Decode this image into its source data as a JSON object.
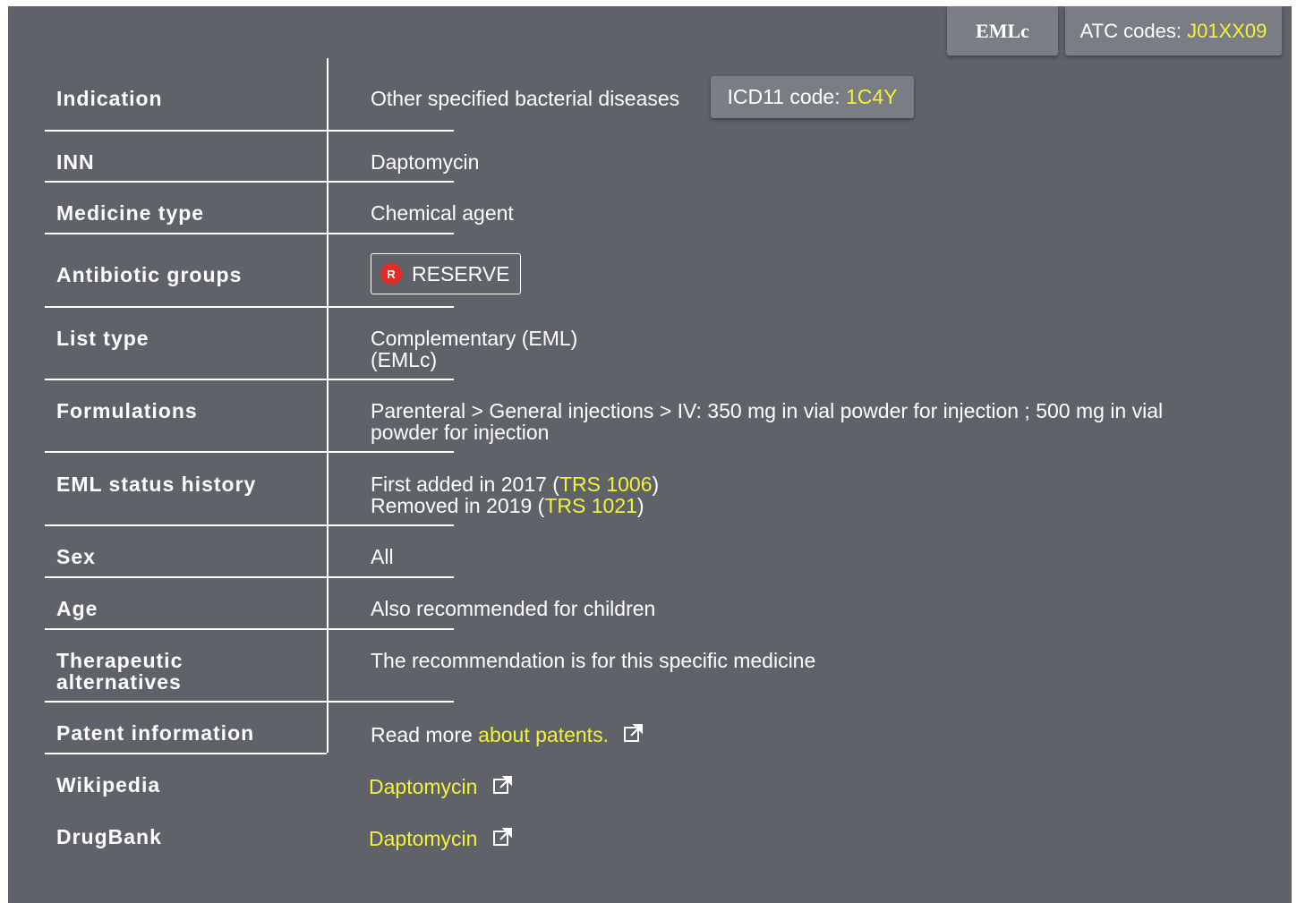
{
  "tags": {
    "emlc": "EMLc",
    "atc_prefix": "ATC codes: ",
    "atc_code": "J01XX09"
  },
  "rows": {
    "indication": {
      "label": "Indication",
      "value": "Other specified bacterial diseases",
      "icd_prefix": "ICD11 code: ",
      "icd_code": "1C4Y"
    },
    "inn": {
      "label": "INN",
      "value": "Daptomycin"
    },
    "medicine_type": {
      "label": "Medicine type",
      "value": "Chemical agent"
    },
    "antibiotic_groups": {
      "label": "Antibiotic groups",
      "badge_letter": "R",
      "badge_label": "RESERVE",
      "badge_color": "#e52b25"
    },
    "list_type": {
      "label": "List type",
      "line1": "Complementary (EML)",
      "line2": "(EMLc)"
    },
    "formulations": {
      "label": "Formulations",
      "line1": "Parenteral > General injections > IV: 350 mg in vial powder for injection ; 500 mg in vial",
      "line2": "powder for injection"
    },
    "eml_status_history": {
      "label": "EML status history",
      "line1_prefix": "First added in 2017 (",
      "line1_link": "TRS 1006",
      "line1_suffix": ")",
      "line2_prefix": "Removed in 2019 (",
      "line2_link": "TRS 1021",
      "line2_suffix": ")"
    },
    "sex": {
      "label": "Sex",
      "value": "All"
    },
    "age": {
      "label": "Age",
      "value": "Also recommended for children"
    },
    "therapeutic_alternatives": {
      "label_line1": "Therapeutic",
      "label_line2": "alternatives",
      "value": "The recommendation is for this specific medicine"
    },
    "patent_information": {
      "label": "Patent information",
      "prefix": "Read more ",
      "link": "about patents."
    },
    "wikipedia": {
      "label": "Wikipedia",
      "link": "Daptomycin"
    },
    "drugbank": {
      "label": "DrugBank",
      "link": "Daptomycin"
    }
  },
  "colors": {
    "panel_bg": "#5f6269",
    "tag_bg": "#7a7d84",
    "link": "#f3f234",
    "reserve_badge": "#e52b25"
  },
  "icons": [
    "external-link-icon"
  ]
}
